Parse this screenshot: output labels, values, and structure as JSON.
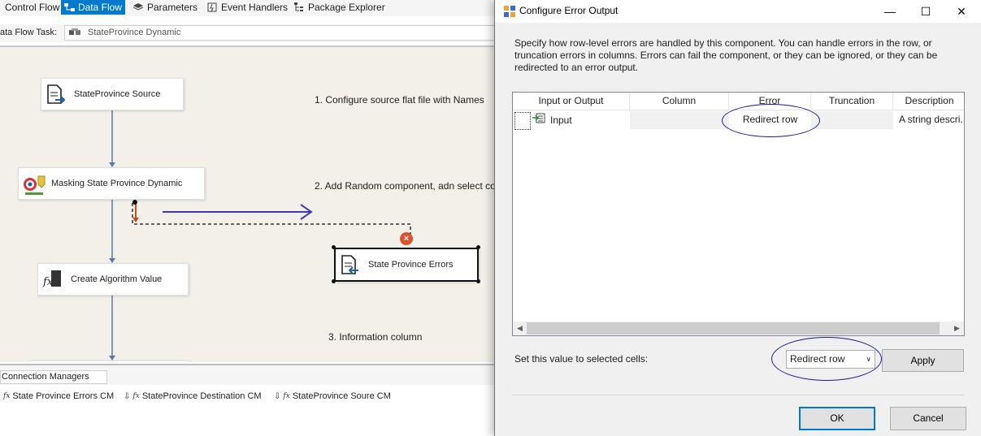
{
  "tabs": [
    {
      "label": "Control Flow",
      "icon": "none"
    },
    {
      "label": "Data Flow",
      "icon": "data-flow-icon"
    },
    {
      "label": "Parameters",
      "icon": "parameters-icon"
    },
    {
      "label": "Event Handlers",
      "icon": "event-handlers-icon"
    },
    {
      "label": "Package Explorer",
      "icon": "package-explorer-icon"
    }
  ],
  "data_flow_task": {
    "label": "ata Flow Task:",
    "value": "StateProvince Dynamic"
  },
  "components": {
    "source": "StateProvince Source",
    "masking": "Masking State Province Dynamic",
    "algorithm": "Create Algorithm Value",
    "errors": "State Province Errors"
  },
  "notes": {
    "step1": "1. Configure source flat file with Names",
    "step2": "2. Add Random component, adn select co",
    "step3": "3. Information column"
  },
  "connection_managers": {
    "tab_label": "Connection Managers",
    "items": [
      {
        "label": "State Province Errors CM",
        "icon": "fx"
      },
      {
        "label": "StateProvince Destination CM",
        "icon": "fx"
      },
      {
        "label": "StateProvince Soure CM",
        "icon": "fx"
      }
    ]
  },
  "dialog": {
    "title": "Configure Error Output",
    "description": "Specify how row-level errors are handled by this component. You can handle errors in the row, or truncation errors in columns. Errors can fail the component, or they can be ignored, or they can be redirected to an error output.",
    "columns": [
      "Input or Output",
      "Column",
      "Error",
      "Truncation",
      "Description"
    ],
    "row": {
      "input_or_output": "Input",
      "column": "",
      "error": "Redirect row",
      "truncation": "",
      "description": "A string descri..."
    },
    "set_value_label": "Set this value to selected cells:",
    "set_value_selected": "Redirect row",
    "apply_label": "Apply",
    "ok_label": "OK",
    "cancel_label": "Cancel",
    "window_controls": {
      "minimize": "—",
      "maximize": "☐",
      "close": "✕"
    }
  },
  "colors": {
    "accent": "#007acc",
    "annotation": "#1a1aa8",
    "error_badge": "#d9532c",
    "canvas": "#f3f0ea"
  }
}
